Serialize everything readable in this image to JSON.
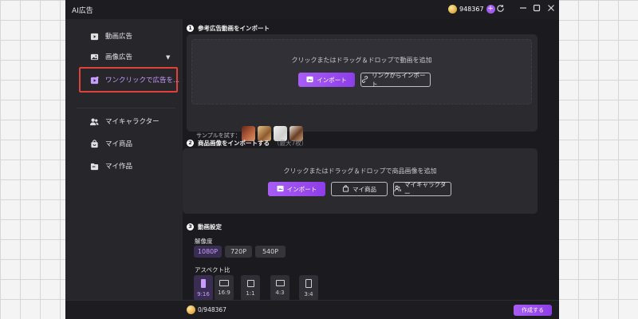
{
  "window": {
    "title": "AI広告"
  },
  "titlebar": {
    "credits": "948367",
    "icons": [
      "coin-icon",
      "plus-icon",
      "refresh-icon",
      "minimize-icon",
      "maximize-icon",
      "close-icon"
    ]
  },
  "sidebar": {
    "items": [
      {
        "label": "動画広告",
        "icon": "video-icon"
      },
      {
        "label": "画像広告",
        "icon": "image-icon"
      },
      {
        "label": "ワンクリックで広告を...",
        "icon": "oneclick-icon",
        "active": true
      },
      {
        "label": "マイキャラクター",
        "icon": "users-icon"
      },
      {
        "label": "マイ商品",
        "icon": "bag-icon"
      },
      {
        "label": "マイ作品",
        "icon": "folder-icon"
      }
    ]
  },
  "sections": {
    "s1": {
      "number": "1",
      "title": "参考広告動画をインポート",
      "hint": "クリックまたはドラッグ＆ドロップで動画を追加",
      "import_label": "インポート",
      "link_import_label": "リンクからインポート",
      "sample_label": "サンプルを試す："
    },
    "s2": {
      "number": "2",
      "title": "商品画像をインポートする",
      "subtitle": "（最大7枚）",
      "hint": "クリックまたはドラッグ＆ドロップで商品画像を追加",
      "import_label": "インポート",
      "my_products_label": "マイ商品",
      "my_characters_label": "マイキャラクター"
    },
    "s3": {
      "number": "3",
      "title": "動画設定",
      "resolution_label": "解像度",
      "resolutions": [
        "1080P",
        "720P",
        "540P"
      ],
      "selected_resolution": "1080P",
      "aspect_label": "アスペクト比",
      "aspects": [
        "9:16",
        "16:9",
        "1:1",
        "4:3",
        "3:4"
      ],
      "selected_aspect": "9:16"
    }
  },
  "footer": {
    "credits": "0/948367",
    "create_label": "作成する"
  },
  "colors": {
    "accent": "#9b4cf0",
    "highlight_border": "#e0423a",
    "background": "#1b1b1f"
  }
}
